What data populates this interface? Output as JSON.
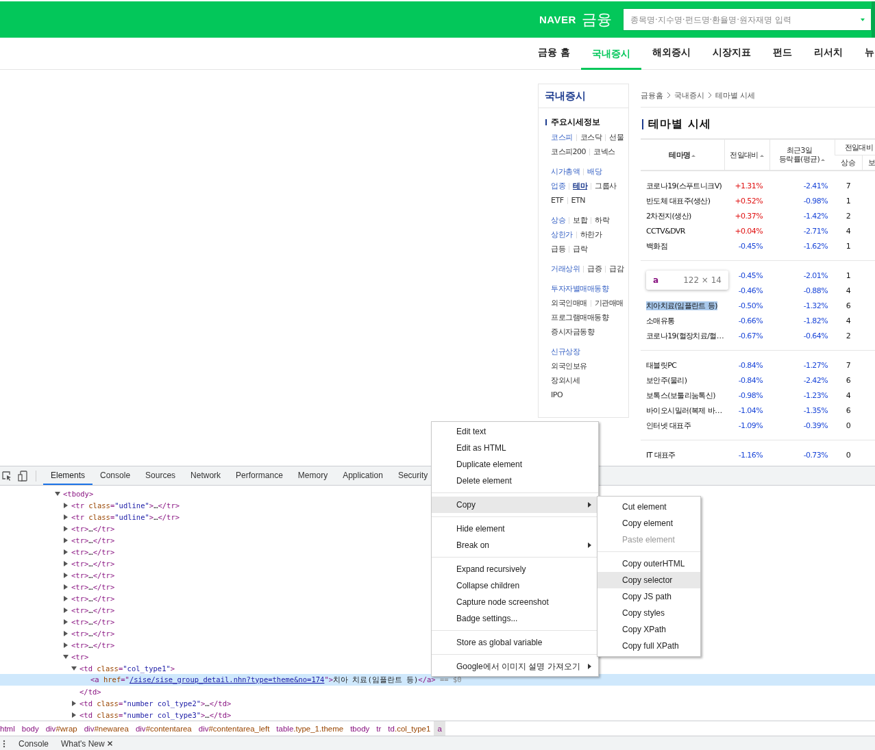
{
  "header": {
    "logo": "NAVER",
    "service": "금융",
    "search": {
      "placeholder": "종목명·지수명·펀드명·환율명·원자재명 입력"
    }
  },
  "nav": [
    {
      "label": "금융 홈",
      "selected": false
    },
    {
      "label": "국내증시",
      "selected": true
    },
    {
      "label": "해외증시",
      "selected": false
    },
    {
      "label": "시장지표",
      "selected": false
    },
    {
      "label": "펀드",
      "selected": false
    },
    {
      "label": "리서치",
      "selected": false
    },
    {
      "label": "뉴",
      "selected": false
    }
  ],
  "sidebar": {
    "title": "국내증시",
    "heading": "주요시세정보",
    "groups": [
      [
        [
          {
            "label": "코스피",
            "kind": "primary",
            "selected": false
          },
          {
            "label": "코스닥",
            "kind": "plain",
            "selected": false
          },
          {
            "label": "선물",
            "kind": "plain",
            "selected": false
          }
        ],
        [
          {
            "label": "코스피200",
            "kind": "plain",
            "selected": false
          },
          {
            "label": "코넥스",
            "kind": "plain",
            "selected": false
          }
        ]
      ],
      [
        [
          {
            "label": "시가총액",
            "kind": "primary",
            "selected": false
          },
          {
            "label": "배당",
            "kind": "primary",
            "selected": false
          }
        ],
        [
          {
            "label": "업종",
            "kind": "primary",
            "selected": false
          },
          {
            "label": "테마",
            "kind": "primary",
            "selected": true
          },
          {
            "label": "그룹사",
            "kind": "plain",
            "selected": false
          }
        ],
        [
          {
            "label": "ETF",
            "kind": "plain",
            "selected": false
          },
          {
            "label": "ETN",
            "kind": "plain",
            "selected": false
          }
        ]
      ],
      [
        [
          {
            "label": "상승",
            "kind": "primary",
            "selected": false
          },
          {
            "label": "보합",
            "kind": "plain",
            "selected": false
          },
          {
            "label": "하락",
            "kind": "plain",
            "selected": false
          }
        ],
        [
          {
            "label": "상한가",
            "kind": "primary",
            "selected": false
          },
          {
            "label": "하한가",
            "kind": "plain",
            "selected": false
          }
        ],
        [
          {
            "label": "급등",
            "kind": "plain",
            "selected": false
          },
          {
            "label": "급락",
            "kind": "plain",
            "selected": false
          }
        ]
      ],
      [
        [
          {
            "label": "거래상위",
            "kind": "primary",
            "selected": false
          },
          {
            "label": "급증",
            "kind": "plain",
            "selected": false
          },
          {
            "label": "급감",
            "kind": "plain",
            "selected": false
          }
        ]
      ],
      [
        [
          {
            "label": "투자자별매매동향",
            "kind": "primary",
            "selected": false
          }
        ],
        [
          {
            "label": "외국인매매",
            "kind": "plain",
            "selected": false
          },
          {
            "label": "기관매매",
            "kind": "plain",
            "selected": false
          }
        ],
        [
          {
            "label": "프로그램매매동향",
            "kind": "plain",
            "selected": false
          }
        ],
        [
          {
            "label": "증시자금동향",
            "kind": "plain",
            "selected": false
          }
        ]
      ],
      [
        [
          {
            "label": "신규상장",
            "kind": "primary",
            "selected": false
          }
        ],
        [
          {
            "label": "외국인보유",
            "kind": "plain",
            "selected": false
          }
        ],
        [
          {
            "label": "장외시세",
            "kind": "plain",
            "selected": false
          }
        ],
        [
          {
            "label": "IPO",
            "kind": "plain",
            "selected": false
          }
        ]
      ]
    ]
  },
  "breadcrumb": [
    "금융홈",
    "국내증시",
    "테마별 시세"
  ],
  "title": "테마별 시세",
  "table": {
    "columns": [
      {
        "label": "테마명",
        "sortable": true
      },
      {
        "label": "전일대비",
        "sortable": true
      },
      {
        "label": "최근3일\n등락률(평균)",
        "sortable": true
      }
    ],
    "column_group": {
      "label": "전일대비",
      "sub": [
        "상승",
        "보"
      ]
    },
    "groups": [
      {
        "rows": [
          {
            "name": "코로나19(스푸트니크V)",
            "change": "+1.31%",
            "rising": true,
            "avg3": "-2.41%",
            "up": "7",
            "highlighted": false
          },
          {
            "name": "반도체 대표주(생산)",
            "change": "+0.52%",
            "rising": true,
            "avg3": "-0.98%",
            "up": "1",
            "highlighted": false
          },
          {
            "name": "2차전지(생산)",
            "change": "+0.37%",
            "rising": true,
            "avg3": "-1.42%",
            "up": "2",
            "highlighted": false
          },
          {
            "name": "CCTV&DVR",
            "change": "+0.04%",
            "rising": true,
            "avg3": "-2.71%",
            "up": "4",
            "highlighted": false
          },
          {
            "name": "백화점",
            "change": "-0.45%",
            "rising": false,
            "avg3": "-1.62%",
            "up": "1",
            "highlighted": false
          }
        ]
      },
      {
        "rows": [
          {
            "change": "-0.45%",
            "rising": false,
            "avg3": "-2.01%",
            "up": "1"
          },
          {
            "change": "-0.46%",
            "rising": false,
            "avg3": "-0.88%",
            "up": "4"
          },
          {
            "name": "치아치료(임플란트 등)",
            "change": "-0.50%",
            "rising": false,
            "avg3": "-1.32%",
            "up": "6",
            "highlighted": true
          },
          {
            "name": "소매유통",
            "change": "-0.66%",
            "rising": false,
            "avg3": "-1.82%",
            "up": "4",
            "highlighted": false
          },
          {
            "name": "코로나19(혈장치료/혈…",
            "change": "-0.67%",
            "rising": false,
            "avg3": "-0.64%",
            "up": "2",
            "highlighted": false
          }
        ]
      },
      {
        "rows": [
          {
            "name": "태블릿PC",
            "change": "-0.84%",
            "rising": false,
            "avg3": "-1.27%",
            "up": "7",
            "highlighted": false
          },
          {
            "name": "보안주(물리)",
            "change": "-0.84%",
            "rising": false,
            "avg3": "-2.42%",
            "up": "6",
            "highlighted": false
          },
          {
            "name": "보톡스(보툴리눔톡신)",
            "change": "-0.98%",
            "rising": false,
            "avg3": "-1.23%",
            "up": "4",
            "highlighted": false
          },
          {
            "name": "바이오시밀러(복제 바…",
            "change": "-1.04%",
            "rising": false,
            "avg3": "-1.35%",
            "up": "6",
            "highlighted": false
          },
          {
            "name": "인터넷 대표주",
            "change": "-1.09%",
            "rising": false,
            "avg3": "-0.39%",
            "up": "0",
            "highlighted": false
          }
        ]
      },
      {
        "rows": [
          {
            "name": "IT 대표주",
            "change": "-1.16%",
            "rising": false,
            "avg3": "-0.73%",
            "up": "0",
            "highlighted": false
          }
        ]
      }
    ]
  },
  "tooltip": {
    "tag": "a",
    "size": "122 × 14"
  },
  "devtools": {
    "tabs": [
      {
        "label": "Elements",
        "selected": true
      },
      {
        "label": "Console",
        "selected": false
      },
      {
        "label": "Sources",
        "selected": false
      },
      {
        "label": "Network",
        "selected": false
      },
      {
        "label": "Performance",
        "selected": false
      },
      {
        "label": "Memory",
        "selected": false
      },
      {
        "label": "Application",
        "selected": false
      },
      {
        "label": "Security",
        "selected": false
      }
    ],
    "tree": [
      {
        "tokens": [
          {
            "kind": "tag",
            "text": "<tbody>"
          }
        ],
        "expanded": true,
        "selected": false,
        "children": [
          {
            "tokens": [
              {
                "kind": "tag",
                "text": "<tr"
              },
              {
                "kind": "attr",
                "text": " class"
              },
              {
                "kind": "tag",
                "text": "="
              },
              {
                "kind": "value",
                "text": "\"udline\""
              },
              {
                "kind": "tag",
                "text": ">"
              },
              {
                "kind": "plain",
                "text": "…"
              },
              {
                "kind": "tag",
                "text": "</tr>"
              }
            ],
            "expanded": false,
            "selected": false
          },
          {
            "tokens": [
              {
                "kind": "tag",
                "text": "<tr"
              },
              {
                "kind": "attr",
                "text": " class"
              },
              {
                "kind": "tag",
                "text": "="
              },
              {
                "kind": "value",
                "text": "\"udline\""
              },
              {
                "kind": "tag",
                "text": ">"
              },
              {
                "kind": "plain",
                "text": "…"
              },
              {
                "kind": "tag",
                "text": "</tr>"
              }
            ],
            "expanded": false,
            "selected": false
          },
          {
            "tokens": [
              {
                "kind": "tag",
                "text": "<tr>"
              },
              {
                "kind": "plain",
                "text": "…"
              },
              {
                "kind": "tag",
                "text": "</tr>"
              }
            ],
            "expanded": false,
            "selected": false
          },
          {
            "tokens": [
              {
                "kind": "tag",
                "text": "<tr>"
              },
              {
                "kind": "plain",
                "text": "…"
              },
              {
                "kind": "tag",
                "text": "</tr>"
              }
            ],
            "expanded": false,
            "selected": false
          },
          {
            "tokens": [
              {
                "kind": "tag",
                "text": "<tr>"
              },
              {
                "kind": "plain",
                "text": "…"
              },
              {
                "kind": "tag",
                "text": "</tr>"
              }
            ],
            "expanded": false,
            "selected": false
          },
          {
            "tokens": [
              {
                "kind": "tag",
                "text": "<tr>"
              },
              {
                "kind": "plain",
                "text": "…"
              },
              {
                "kind": "tag",
                "text": "</tr>"
              }
            ],
            "expanded": false,
            "selected": false
          },
          {
            "tokens": [
              {
                "kind": "tag",
                "text": "<tr>"
              },
              {
                "kind": "plain",
                "text": "…"
              },
              {
                "kind": "tag",
                "text": "</tr>"
              }
            ],
            "expanded": false,
            "selected": false
          },
          {
            "tokens": [
              {
                "kind": "tag",
                "text": "<tr>"
              },
              {
                "kind": "plain",
                "text": "…"
              },
              {
                "kind": "tag",
                "text": "</tr>"
              }
            ],
            "expanded": false,
            "selected": false
          },
          {
            "tokens": [
              {
                "kind": "tag",
                "text": "<tr>"
              },
              {
                "kind": "plain",
                "text": "…"
              },
              {
                "kind": "tag",
                "text": "</tr>"
              }
            ],
            "expanded": false,
            "selected": false
          },
          {
            "tokens": [
              {
                "kind": "tag",
                "text": "<tr>"
              },
              {
                "kind": "plain",
                "text": "…"
              },
              {
                "kind": "tag",
                "text": "</tr>"
              }
            ],
            "expanded": false,
            "selected": false
          },
          {
            "tokens": [
              {
                "kind": "tag",
                "text": "<tr>"
              },
              {
                "kind": "plain",
                "text": "…"
              },
              {
                "kind": "tag",
                "text": "</tr>"
              }
            ],
            "expanded": false,
            "selected": false
          },
          {
            "tokens": [
              {
                "kind": "tag",
                "text": "<tr>"
              },
              {
                "kind": "plain",
                "text": "…"
              },
              {
                "kind": "tag",
                "text": "</tr>"
              }
            ],
            "expanded": false,
            "selected": false
          },
          {
            "tokens": [
              {
                "kind": "tag",
                "text": "<tr>"
              },
              {
                "kind": "plain",
                "text": "…"
              },
              {
                "kind": "tag",
                "text": "</tr>"
              }
            ],
            "expanded": false,
            "selected": false
          },
          {
            "tokens": [
              {
                "kind": "tag",
                "text": "<tr>"
              }
            ],
            "expanded": true,
            "selected": false,
            "children": [
              {
                "tokens": [
                  {
                    "kind": "tag",
                    "text": "<td"
                  },
                  {
                    "kind": "attr",
                    "text": " class"
                  },
                  {
                    "kind": "tag",
                    "text": "="
                  },
                  {
                    "kind": "value",
                    "text": "\"col_type1\""
                  },
                  {
                    "kind": "tag",
                    "text": ">"
                  }
                ],
                "expanded": true,
                "selected": false,
                "children": [
                  {
                    "tokens": [
                      {
                        "kind": "tag",
                        "text": "<a"
                      },
                      {
                        "kind": "attr",
                        "text": " href"
                      },
                      {
                        "kind": "tag",
                        "text": "=\""
                      },
                      {
                        "kind": "link",
                        "text": "/sise/sise_group_detail.nhn?type=theme&no=174"
                      },
                      {
                        "kind": "tag",
                        "text": "\">"
                      },
                      {
                        "kind": "plain",
                        "text": "치아 치료(임플란트 등)"
                      },
                      {
                        "kind": "tag",
                        "text": "</a>"
                      },
                      {
                        "kind": "dim",
                        "text": " == $0"
                      }
                    ],
                    "selected": true
                  }
                ],
                "close": [
                  {
                    "kind": "tag",
                    "text": "</td>"
                  }
                ]
              },
              {
                "tokens": [
                  {
                    "kind": "tag",
                    "text": "<td"
                  },
                  {
                    "kind": "attr",
                    "text": " class"
                  },
                  {
                    "kind": "tag",
                    "text": "="
                  },
                  {
                    "kind": "value",
                    "text": "\"number col_type2\""
                  },
                  {
                    "kind": "tag",
                    "text": ">"
                  },
                  {
                    "kind": "plain",
                    "text": "…"
                  },
                  {
                    "kind": "tag",
                    "text": "</td>"
                  }
                ],
                "expanded": false,
                "selected": false
              },
              {
                "tokens": [
                  {
                    "kind": "tag",
                    "text": "<td"
                  },
                  {
                    "kind": "attr",
                    "text": " class"
                  },
                  {
                    "kind": "tag",
                    "text": "="
                  },
                  {
                    "kind": "value",
                    "text": "\"number col_type3\""
                  },
                  {
                    "kind": "tag",
                    "text": ">"
                  },
                  {
                    "kind": "plain",
                    "text": "…"
                  },
                  {
                    "kind": "tag",
                    "text": "</td>"
                  }
                ],
                "expanded": false,
                "selected": false
              }
            ]
          }
        ]
      }
    ],
    "breadcrumbs": [
      {
        "tag": "html",
        "selected": false
      },
      {
        "tag": "body",
        "selected": false
      },
      {
        "tag": "div",
        "suffix": "#wrap",
        "selected": false
      },
      {
        "tag": "div",
        "suffix": "#newarea",
        "selected": false
      },
      {
        "tag": "div",
        "suffix": "#contentarea",
        "selected": false
      },
      {
        "tag": "div",
        "suffix": "#contentarea_left",
        "selected": false
      },
      {
        "tag": "table",
        "suffix": ".type_1.theme",
        "selected": false
      },
      {
        "tag": "tbody",
        "selected": false
      },
      {
        "tag": "tr",
        "selected": false
      },
      {
        "tag": "td",
        "suffix": ".col_type1",
        "selected": false
      },
      {
        "tag": "a",
        "selected": true
      }
    ],
    "drawer": [
      {
        "label": "Console",
        "closable": false
      },
      {
        "label": "What's New",
        "closable": true
      }
    ]
  },
  "context_menu": {
    "groups": [
      [
        {
          "label": "Edit text",
          "highlighted": false,
          "has_submenu": false
        },
        {
          "label": "Edit as HTML",
          "highlighted": false,
          "has_submenu": false
        },
        {
          "label": "Duplicate element",
          "highlighted": false,
          "has_submenu": false
        },
        {
          "label": "Delete element",
          "highlighted": false,
          "has_submenu": false
        }
      ],
      [
        {
          "label": "Copy",
          "highlighted": true,
          "has_submenu": true
        }
      ],
      [
        {
          "label": "Hide element",
          "highlighted": false,
          "has_submenu": false
        },
        {
          "label": "Break on",
          "highlighted": false,
          "has_submenu": true
        }
      ],
      [
        {
          "label": "Expand recursively",
          "highlighted": false,
          "has_submenu": false
        },
        {
          "label": "Collapse children",
          "highlighted": false,
          "has_submenu": false
        },
        {
          "label": "Capture node screenshot",
          "highlighted": false,
          "has_submenu": false
        },
        {
          "label": "Badge settings...",
          "highlighted": false,
          "has_submenu": false
        }
      ],
      [
        {
          "label": "Store as global variable",
          "highlighted": false,
          "has_submenu": false
        }
      ],
      [
        {
          "label": "Google에서 이미지 설명 가져오기",
          "highlighted": false,
          "has_submenu": true
        }
      ]
    ],
    "submenu": {
      "groups": [
        [
          {
            "label": "Cut element",
            "highlighted": false,
            "disabled": false
          },
          {
            "label": "Copy element",
            "highlighted": false,
            "disabled": false
          },
          {
            "label": "Paste element",
            "highlighted": false,
            "disabled": true
          }
        ],
        [
          {
            "label": "Copy outerHTML",
            "highlighted": false,
            "disabled": false
          },
          {
            "label": "Copy selector",
            "highlighted": true,
            "disabled": false
          },
          {
            "label": "Copy JS path",
            "highlighted": false,
            "disabled": false
          },
          {
            "label": "Copy styles",
            "highlighted": false,
            "disabled": false
          },
          {
            "label": "Copy XPath",
            "highlighted": false,
            "disabled": false
          },
          {
            "label": "Copy full XPath",
            "highlighted": false,
            "disabled": false
          }
        ]
      ]
    }
  }
}
